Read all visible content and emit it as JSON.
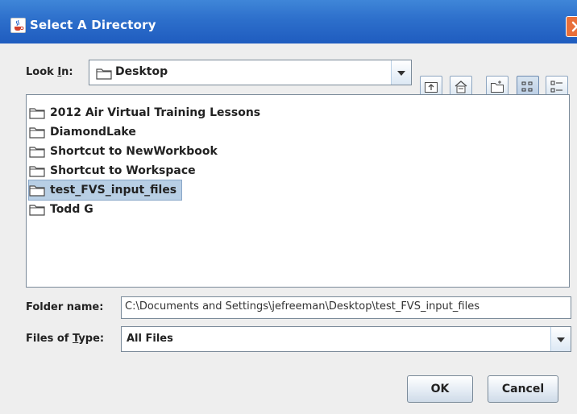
{
  "window": {
    "title": "Select A Directory",
    "app_icon": "java-cup-icon",
    "close_icon": "close-icon"
  },
  "look_in": {
    "label_pre": "Look ",
    "label_mnemonic": "I",
    "label_post": "n:",
    "value": "Desktop",
    "dropdown_icon": "chevron-down-icon"
  },
  "toolbar": {
    "buttons": [
      {
        "icon": "up-one-level-icon"
      },
      {
        "icon": "home-icon"
      },
      {
        "icon": "new-folder-icon"
      },
      {
        "icon": "list-view-icon",
        "selected": true
      },
      {
        "icon": "details-view-icon"
      }
    ]
  },
  "files": [
    {
      "name": "2012 Air Virtual Training Lessons",
      "type": "folder",
      "selected": false
    },
    {
      "name": "DiamondLake",
      "type": "folder",
      "selected": false
    },
    {
      "name": "Shortcut to NewWorkbook",
      "type": "folder",
      "selected": false
    },
    {
      "name": "Shortcut to Workspace",
      "type": "folder",
      "selected": false
    },
    {
      "name": "test_FVS_input_files",
      "type": "folder",
      "selected": true
    },
    {
      "name": "Todd G",
      "type": "folder",
      "selected": false
    }
  ],
  "folder_name": {
    "label": "Folder name:",
    "value": "C:\\Documents and Settings\\jefreeman\\Desktop\\test_FVS_input_files"
  },
  "files_of_type": {
    "label_pre": "Files of ",
    "label_mnemonic": "T",
    "label_post": "ype:",
    "value": "All Files"
  },
  "buttons": {
    "ok": "OK",
    "cancel": "Cancel"
  },
  "colors": {
    "title_bar": "#2d6fcb",
    "selection": "#b8cfe5",
    "close_button": "#e96f3a"
  }
}
